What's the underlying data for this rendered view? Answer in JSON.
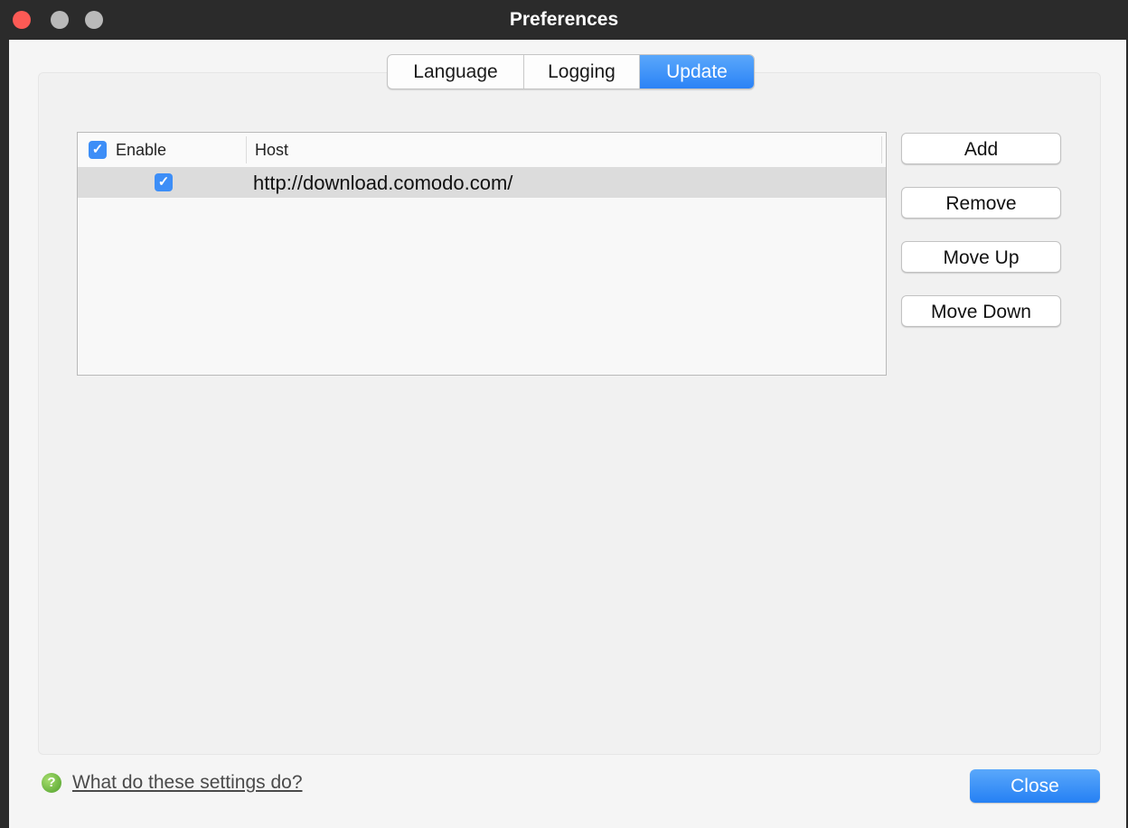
{
  "window": {
    "title": "Preferences"
  },
  "tabs": [
    {
      "label": "Language",
      "active": false
    },
    {
      "label": "Logging",
      "active": false
    },
    {
      "label": "Update",
      "active": true
    }
  ],
  "table": {
    "columns": {
      "enable": "Enable",
      "host": "Host"
    },
    "header_checked": true,
    "rows": [
      {
        "enabled": true,
        "host": "http://download.comodo.com/"
      }
    ]
  },
  "buttons": {
    "add": "Add",
    "remove": "Remove",
    "move_up": "Move Up",
    "move_down": "Move Down"
  },
  "footer": {
    "help_link": "What do these settings do?",
    "close": "Close"
  },
  "colors": {
    "accent": "#2b83f6",
    "titlebar": "#2b2b2b",
    "close_light": "#fc5a55"
  }
}
